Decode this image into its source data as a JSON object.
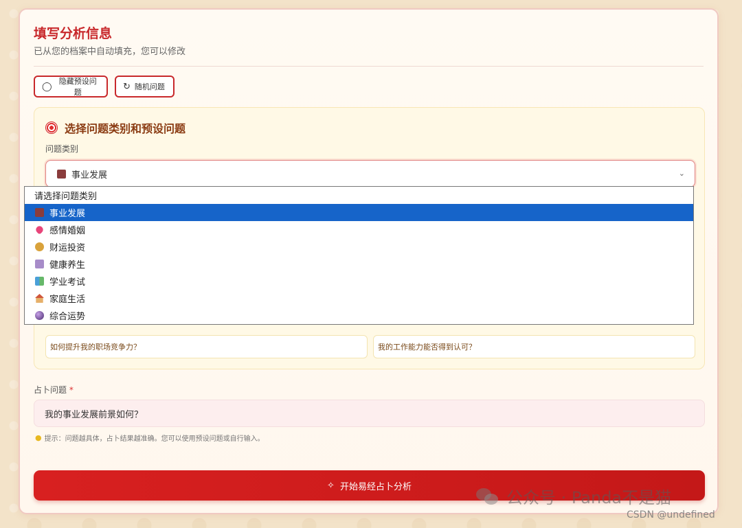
{
  "header": {
    "title": "填写分析信息",
    "subtitle": "已从您的档案中自动填充，您可以修改"
  },
  "toolbar": {
    "hide_label": "隐藏预设问题",
    "random_label": "随机问题"
  },
  "panel": {
    "title": "选择问题类别和预设问题",
    "category_label": "问题类别",
    "selected_category": "事业发展"
  },
  "dropdown": {
    "placeholder": "请选择问题类别",
    "options": [
      {
        "label": "事业发展",
        "icon": "briefcase-icon"
      },
      {
        "label": "感情婚姻",
        "icon": "heart-icon"
      },
      {
        "label": "财运投资",
        "icon": "money-bag-icon"
      },
      {
        "label": "健康养生",
        "icon": "book-icon"
      },
      {
        "label": "学业考试",
        "icon": "books-icon"
      },
      {
        "label": "家庭生活",
        "icon": "house-icon"
      },
      {
        "label": "综合运势",
        "icon": "crystal-ball-icon"
      }
    ]
  },
  "presets": [
    "如何提升我的职场竞争力？",
    "我的工作能力能否得到认可？"
  ],
  "question": {
    "label": "占卜问题",
    "required_mark": "*",
    "value": "我的事业发展前景如何？",
    "hint": "提示：问题越具体，占卜结果越准确。您可以使用预设问题或自行输入。"
  },
  "submit": {
    "label": "开始易经占卜分析"
  },
  "watermark": {
    "text": "公众号 · Panda不是猫",
    "source": "CSDN @undefined"
  },
  "colors": {
    "accent": "#c8282b",
    "selected_option": "#1664c9",
    "submit_bg": "#d82020"
  }
}
